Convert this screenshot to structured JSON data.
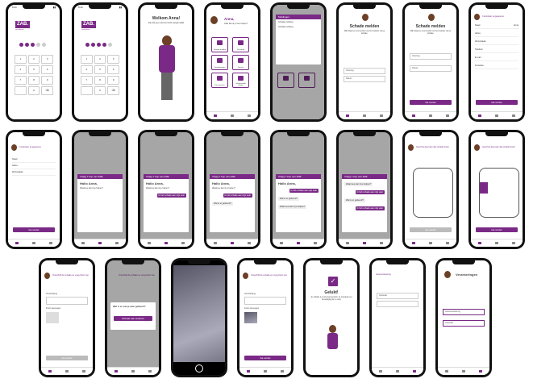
{
  "colors": {
    "accent": "#7a2a86",
    "text": "#333333"
  },
  "status_time": "9:41",
  "login": {
    "logo": "ZAB.",
    "subtitle": "verzekeraar",
    "keys": [
      "1",
      "2",
      "3",
      "4",
      "5",
      "6",
      "7",
      "8",
      "9",
      "",
      "0",
      "⌫"
    ]
  },
  "welcome": {
    "title": "Welkom Anna!",
    "text": "Fijn dat je je account hebt aangemaakt"
  },
  "home": {
    "greeting": "Anna,",
    "sub": "waar kan ik je mee helpen?",
    "tiles": [
      "Schade melden",
      "Pechhulp",
      "Verzekeringen",
      "Dossier",
      "Documenten",
      "Veelgestelde vragen"
    ]
  },
  "notifications": {
    "title": "Meldingen",
    "items": [
      "Schade melding",
      "Schade melding"
    ]
  },
  "report": {
    "title": "Schade melden",
    "intro": "Wij helpen je snel verder met het melden van je schade.",
    "fields": [
      "Voertuig",
      "Datum"
    ],
    "next": "Ga verder"
  },
  "details": {
    "header": "Controleer je gegevens",
    "rows": [
      [
        "Naam",
        "Anna"
      ],
      [
        "Adres",
        ""
      ],
      [
        "Woonplaats",
        ""
      ],
      [
        "Telefoon",
        ""
      ],
      [
        "E-mail",
        ""
      ],
      [
        "Kenteken",
        ""
      ]
    ],
    "next": "Ga verder"
  },
  "chat": {
    "title": "Vraag 7 kop van ZAB.",
    "greeting": "Hallo Anna,",
    "lines": [
      "Waarmee kan ik je helpen?",
      "Ik heb schade aan mijn auto",
      "Wat is er gebeurd?"
    ]
  },
  "car": {
    "title": "Geef het deel aan dat schade heeft",
    "next": "Ga verder"
  },
  "photo": {
    "title": "Omschrijf de schade en voeg foto's toe",
    "field": "Omschrijving",
    "photo_label": "Foto's toevoegen",
    "next": "Ga verder",
    "dialog_title": "Wat is er met je auto gebeurd?",
    "dialog_btn": "Schade aan anderen"
  },
  "done": {
    "title": "Gelukt!",
    "text": "Je schade is succesvol gemeld. Je ontvangt een bevestiging per e-mail."
  },
  "insurances": {
    "title": "Verzekeringen",
    "cards": [
      "Autoverzekering",
      "Inboedel"
    ]
  }
}
